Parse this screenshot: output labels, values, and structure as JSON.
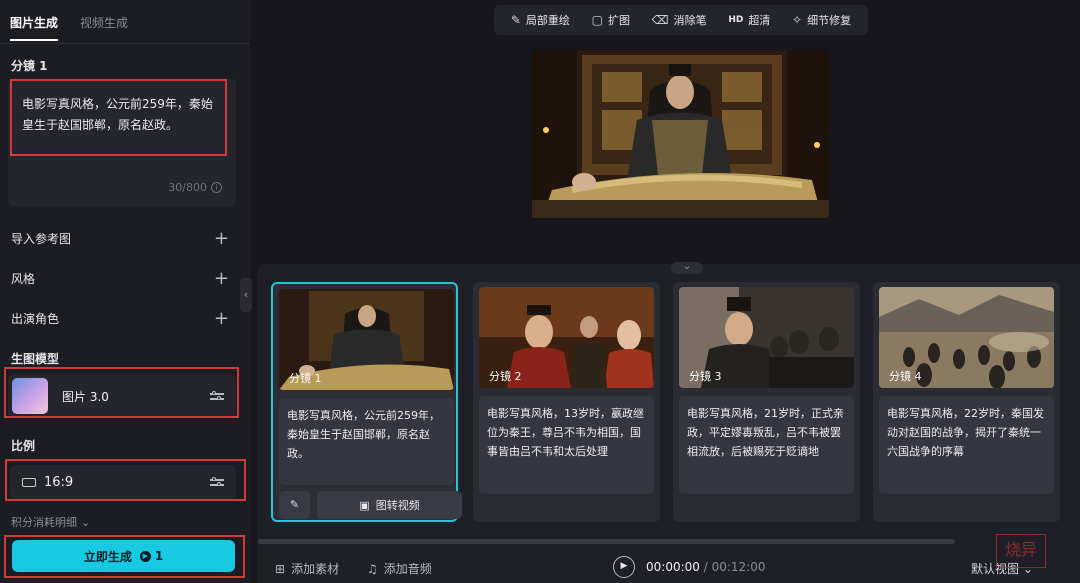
{
  "sidebar": {
    "tabs": [
      {
        "label": "图片生成",
        "active": true
      },
      {
        "label": "视频生成",
        "active": false
      }
    ],
    "storyboard_title": "分镜 1",
    "prompt": "电影写真风格，公元前259年，秦始皇生于赵国邯郸，原名赵政。",
    "char_count": "30/800",
    "rows": [
      {
        "label": "导入参考图",
        "icon": "plus-icon"
      },
      {
        "label": "风格",
        "icon": "plus-icon"
      },
      {
        "label": "出演角色",
        "icon": "plus-icon"
      }
    ],
    "model_title": "生图模型",
    "model_name": "图片 3.0",
    "ratio_title": "比例",
    "ratio_value": "16:9",
    "credits_label": "积分消耗明细",
    "generate_label": "立即生成",
    "generate_cost": "1"
  },
  "toolbar": {
    "items": [
      {
        "label": "局部重绘",
        "icon": "brush-icon"
      },
      {
        "label": "扩图",
        "icon": "expand-icon"
      },
      {
        "label": "消除笔",
        "icon": "eraser-icon"
      },
      {
        "label": "超清",
        "icon": "hd-icon",
        "badge": "HD"
      },
      {
        "label": "细节修复",
        "icon": "magic-wand-icon"
      }
    ]
  },
  "shots": [
    {
      "label": "分镜 1",
      "text": "电影写真风格，公元前259年，秦始皇生于赵国邯郸，原名赵政。",
      "active": true
    },
    {
      "label": "分镜 2",
      "text": "电影写真风格，13岁时，嬴政继位为秦王，尊吕不韦为相国，国事皆由吕不韦和太后处理",
      "active": false
    },
    {
      "label": "分镜 3",
      "text": "电影写真风格，21岁时，正式亲政，平定嫪毐叛乱，吕不韦被罢相流放，后被赐死于贬谪地",
      "active": false
    },
    {
      "label": "分镜 4",
      "text": "电影写真风格，22岁时，秦国发动对赵国的战争，揭开了秦统一六国战争的序幕",
      "active": false
    }
  ],
  "shot_actions": {
    "to_video": "图转视频"
  },
  "bottom": {
    "add_material": "添加素材",
    "add_audio": "添加音频",
    "time_current": "00:00:00",
    "time_sep": " / ",
    "time_total": "00:12:00",
    "view_label": "默认视图"
  },
  "watermark": "烧异",
  "colors": {
    "accent": "#17c9e2",
    "highlight_box": "#d23a3a",
    "active_border": "#27c3d6"
  }
}
